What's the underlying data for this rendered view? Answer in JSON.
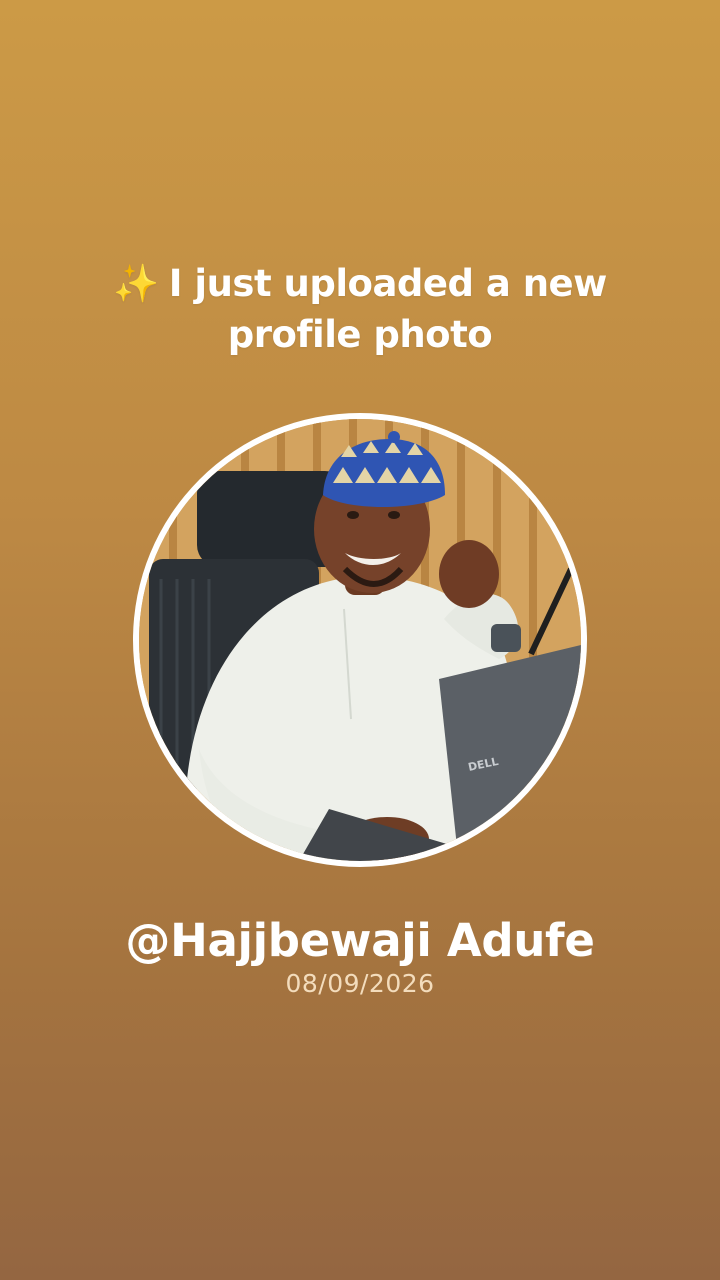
{
  "headline": {
    "icon": "sparkles-icon",
    "sparkle": "✨",
    "text": "I just uploaded a new profile photo"
  },
  "profile": {
    "handle": "@Hajjbewaji Adufe",
    "date": "08/09/2026",
    "laptop_brand": "DELL"
  },
  "colors": {
    "background_top": "#cc9a46",
    "background_bottom": "#946641",
    "ring": "#ffffff",
    "text": "#ffffff",
    "date_text": "#f3dcbc"
  }
}
